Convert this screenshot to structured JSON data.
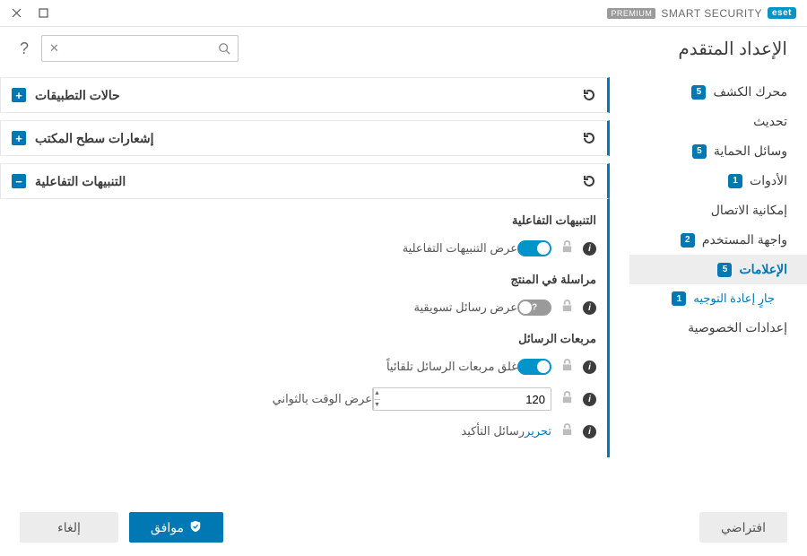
{
  "brand": {
    "logo": "eset",
    "name": "SMART SECURITY",
    "tier": "PREMIUM"
  },
  "header": {
    "title": "الإعداد المتقدم"
  },
  "search": {
    "placeholder": ""
  },
  "sidebar": {
    "items": [
      {
        "label": "محرك الكشف",
        "badge": "5"
      },
      {
        "label": "تحديث",
        "badge": ""
      },
      {
        "label": "وسائل الحماية",
        "badge": "5"
      },
      {
        "label": "الأدوات",
        "badge": "1"
      },
      {
        "label": "إمكانية الاتصال",
        "badge": ""
      },
      {
        "label": "واجهة المستخدم",
        "badge": "2"
      },
      {
        "label": "الإعلامات",
        "badge": "5"
      },
      {
        "label": "إعدادات الخصوصية",
        "badge": ""
      }
    ],
    "sub": {
      "label": "جارٍ إعادة التوجيه",
      "badge": "1"
    }
  },
  "panels": {
    "app_states": {
      "title": "حالات التطبيقات",
      "expand": "+"
    },
    "desktop_notif": {
      "title": "إشعارات سطح المكتب",
      "expand": "+"
    },
    "interactive": {
      "title": "التنبيهات التفاعلية",
      "expand": "−",
      "sec1": "التنبيهات التفاعلية",
      "row1": "عرض التنبيهات التفاعلية",
      "sec2": "مراسلة في المنتج",
      "row2": "عرض رسائل تسويقية",
      "sec3": "مربعات الرسائل",
      "row3": "غلق مربعات الرسائل تلقائياً",
      "row4": "عرض الوقت بالثواني",
      "row4_value": "120",
      "row5": "رسائل التأكيد",
      "edit": "تحرير"
    }
  },
  "footer": {
    "default": "افتراضي",
    "ok": "موافق",
    "cancel": "إلغاء"
  }
}
